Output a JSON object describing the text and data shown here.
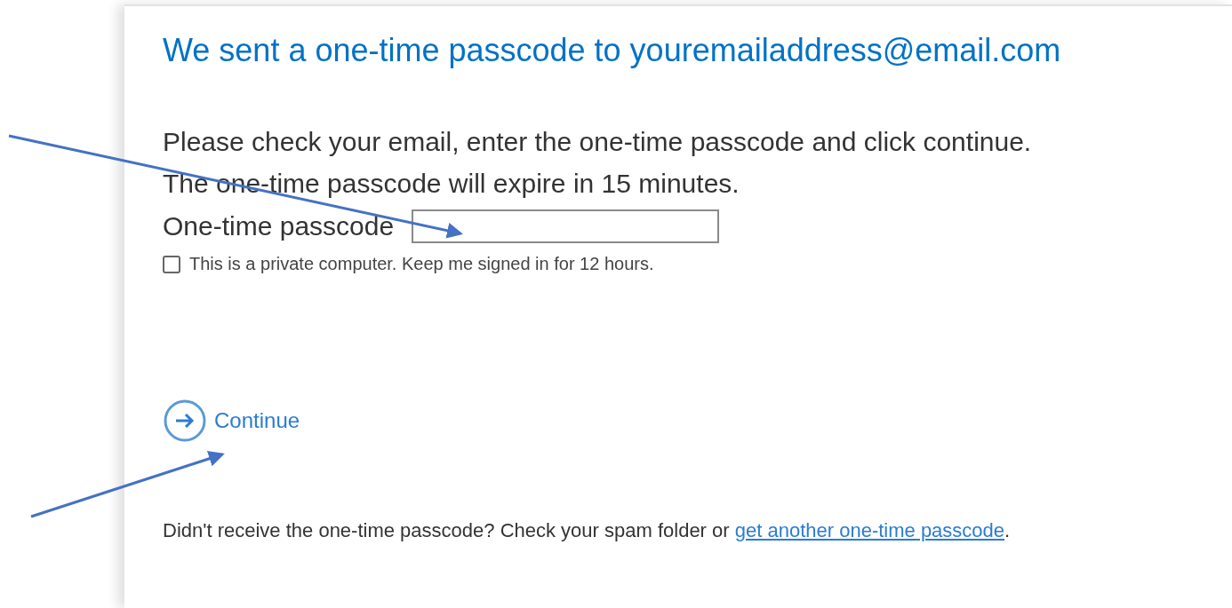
{
  "heading": "We sent a one-time passcode to youremailaddress@email.com",
  "instructions": [
    "Please check your email, enter the one-time passcode and click continue.",
    "The one-time passcode will expire in 15 minutes."
  ],
  "passcode_field": {
    "label": "One-time passcode"
  },
  "remember_checkbox": {
    "label": "This is a private computer. Keep me signed in for 12 hours.",
    "checked": false
  },
  "continue_button": {
    "label": "Continue"
  },
  "help_text": {
    "text": "Didn't receive the one-time passcode? Check your spam folder or ",
    "link": "get another one-time passcode",
    "suffix": "."
  }
}
